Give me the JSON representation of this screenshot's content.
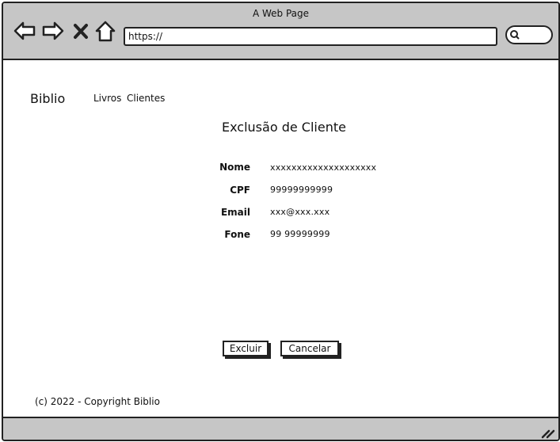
{
  "browser": {
    "window_title": "A Web Page",
    "address": "https://",
    "icons": [
      "back-arrow-icon",
      "forward-arrow-icon",
      "close-icon",
      "home-icon",
      "search-icon"
    ]
  },
  "site": {
    "brand": "Biblio",
    "nav": [
      {
        "label": "Livros"
      },
      {
        "label": "Clientes"
      }
    ]
  },
  "main": {
    "title": "Exclusão de Cliente",
    "fields": [
      {
        "label": "Nome",
        "value": "xxxxxxxxxxxxxxxxxxxx"
      },
      {
        "label": "CPF",
        "value": "99999999999"
      },
      {
        "label": "Email",
        "value": "xxx@xxx.xxx"
      },
      {
        "label": "Fone",
        "value": "99 99999999"
      }
    ],
    "actions": {
      "delete_label": "Excluir",
      "cancel_label": "Cancelar"
    }
  },
  "footer": {
    "copyright": "(c) 2022 - Copyright Biblio"
  }
}
